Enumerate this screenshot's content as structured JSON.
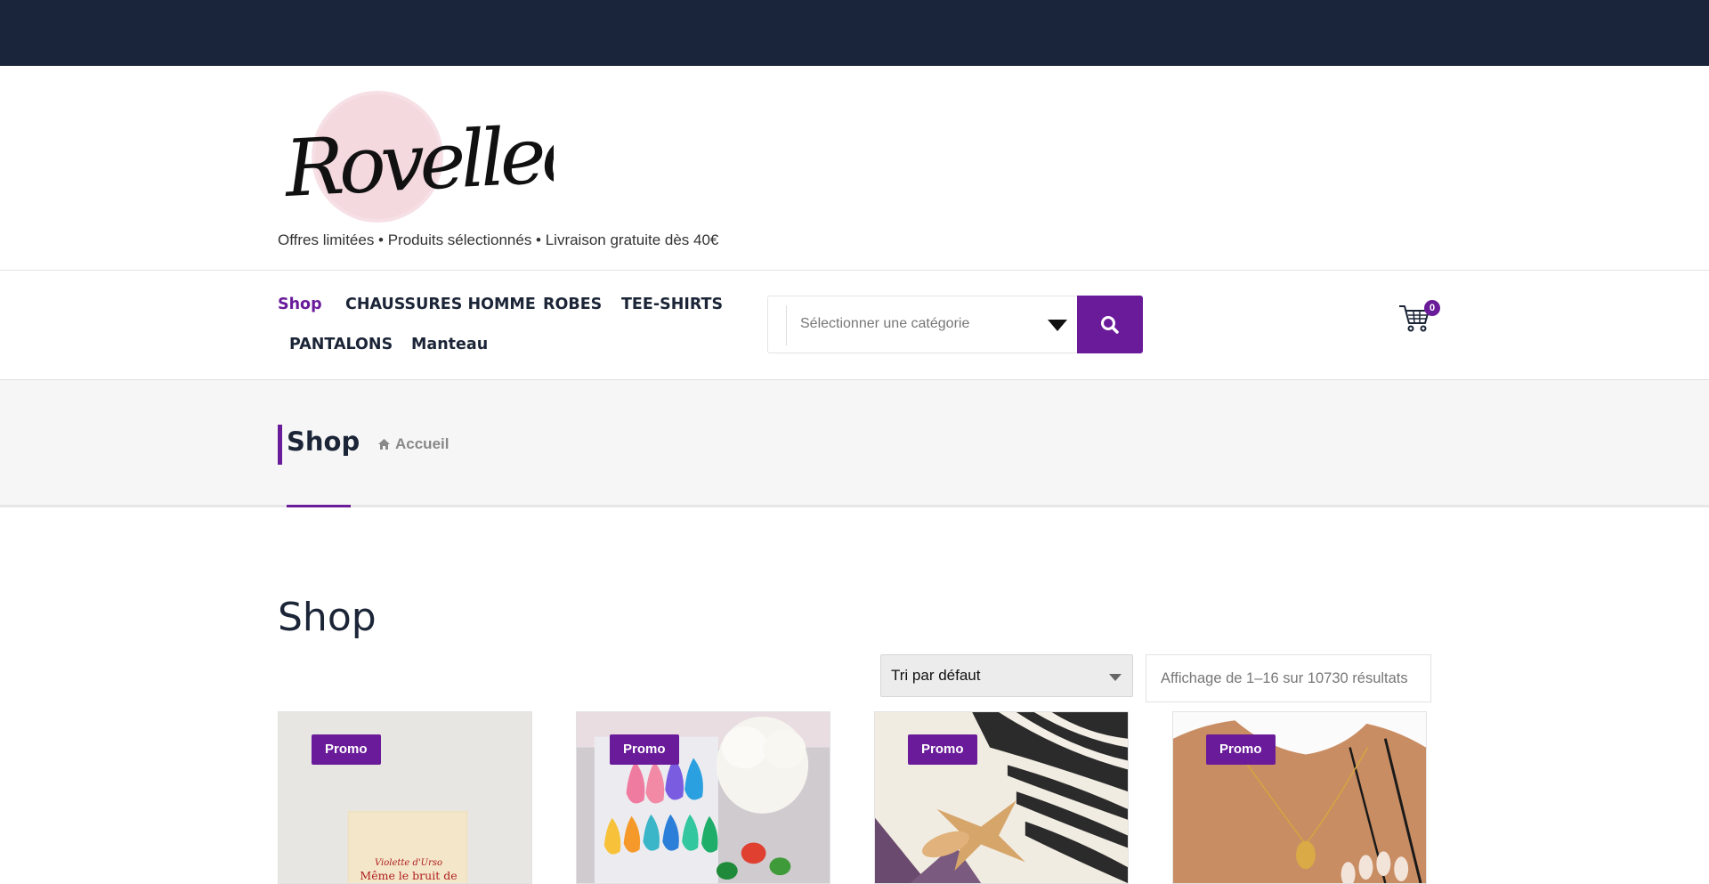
{
  "site": {
    "logo_text": "Rovelleclub",
    "tagline": "Offres limitées • Produits sélectionnés • Livraison gratuite dès 40€"
  },
  "nav": {
    "items": [
      {
        "label": "Shop",
        "active": true
      },
      {
        "label": "CHAUSSURES HOMME",
        "active": false
      },
      {
        "label": "ROBES",
        "active": false
      },
      {
        "label": "TEE-SHIRTS",
        "active": false
      },
      {
        "label": "PANTALONS",
        "active": false
      },
      {
        "label": "Manteau",
        "active": false
      }
    ]
  },
  "search": {
    "category_placeholder": "Sélectionner une catégorie",
    "button_icon": "search-icon"
  },
  "cart": {
    "icon": "cart-icon",
    "count": "0"
  },
  "title_band": {
    "title": "Shop",
    "breadcrumb_icon": "home-icon",
    "breadcrumb_label": "Accueil"
  },
  "main": {
    "heading": "Shop",
    "sort_selected": "Tri par défaut",
    "result_count": "Affichage de 1–16 sur 10730 résultats"
  },
  "products": [
    {
      "badge": "Promo",
      "book_author": "Violette d'Urso",
      "book_title": "Même le bruit de"
    },
    {
      "badge": "Promo"
    },
    {
      "badge": "Promo"
    },
    {
      "badge": "Promo"
    }
  ],
  "colors": {
    "topbar": "#1a253b",
    "accent": "#6a1b9a",
    "text_dark": "#1b2537"
  }
}
